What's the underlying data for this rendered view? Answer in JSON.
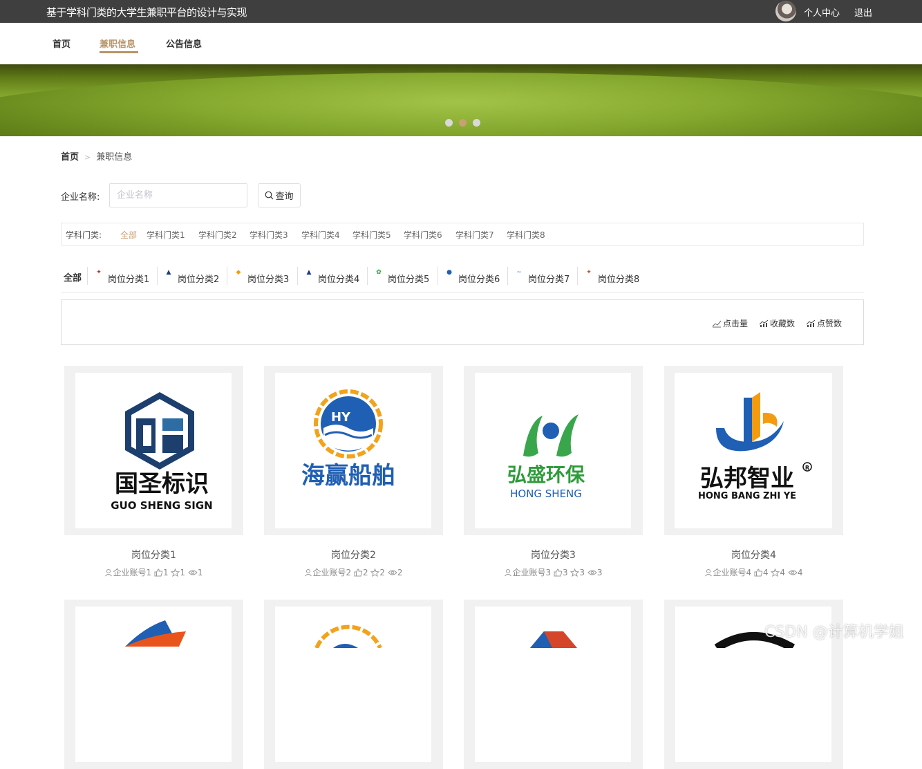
{
  "header": {
    "title": "基于学科门类的大学生兼职平台的设计与实现",
    "user_center": "个人中心",
    "logout": "退出"
  },
  "nav": [
    {
      "label": "首页"
    },
    {
      "label": "兼职信息"
    },
    {
      "label": "公告信息"
    }
  ],
  "banner": {
    "slides": 3,
    "active_slide": 2
  },
  "breadcrumb": {
    "home": "首页",
    "separator": ">",
    "current": "兼职信息"
  },
  "search": {
    "label": "企业名称:",
    "placeholder": "企业名称",
    "value": "",
    "button": "查询"
  },
  "subject_filter": {
    "label": "学科门类:",
    "options": [
      "全部",
      "学科门类1",
      "学科门类2",
      "学科门类3",
      "学科门类4",
      "学科门类5",
      "学科门类6",
      "学科门类7",
      "学科门类8"
    ],
    "selected": "全部"
  },
  "position_categories": {
    "all": "全部",
    "items": [
      "岗位分类1",
      "岗位分类2",
      "岗位分类3",
      "岗位分类4",
      "岗位分类5",
      "岗位分类6",
      "岗位分类7",
      "岗位分类8"
    ]
  },
  "sort": {
    "clicks": "点击量",
    "favorites": "收藏数",
    "likes": "点赞数"
  },
  "cards": [
    {
      "title": "岗位分类1",
      "company": "企业账号1",
      "likes": "1",
      "favorites": "1",
      "views": "1",
      "logo": {
        "cn": "国圣标识",
        "en": "GUO SHENG SIGN"
      }
    },
    {
      "title": "岗位分类2",
      "company": "企业账号2",
      "likes": "2",
      "favorites": "2",
      "views": "2",
      "logo": {
        "cn": "海赢船舶",
        "en": "HY"
      }
    },
    {
      "title": "岗位分类3",
      "company": "企业账号3",
      "likes": "3",
      "favorites": "3",
      "views": "3",
      "logo": {
        "cn": "弘盛环保",
        "en": "HONG  SHENG"
      }
    },
    {
      "title": "岗位分类4",
      "company": "企业账号4",
      "likes": "4",
      "favorites": "4",
      "views": "4",
      "logo": {
        "cn": "弘邦智业",
        "en": "HONG BANG ZHI YE"
      }
    }
  ],
  "watermark": "CSDN @计算机学姐",
  "colors": {
    "accent": "#b8946a",
    "topbar": "#3f3f3f",
    "card_bg": "#f1f1f1"
  }
}
